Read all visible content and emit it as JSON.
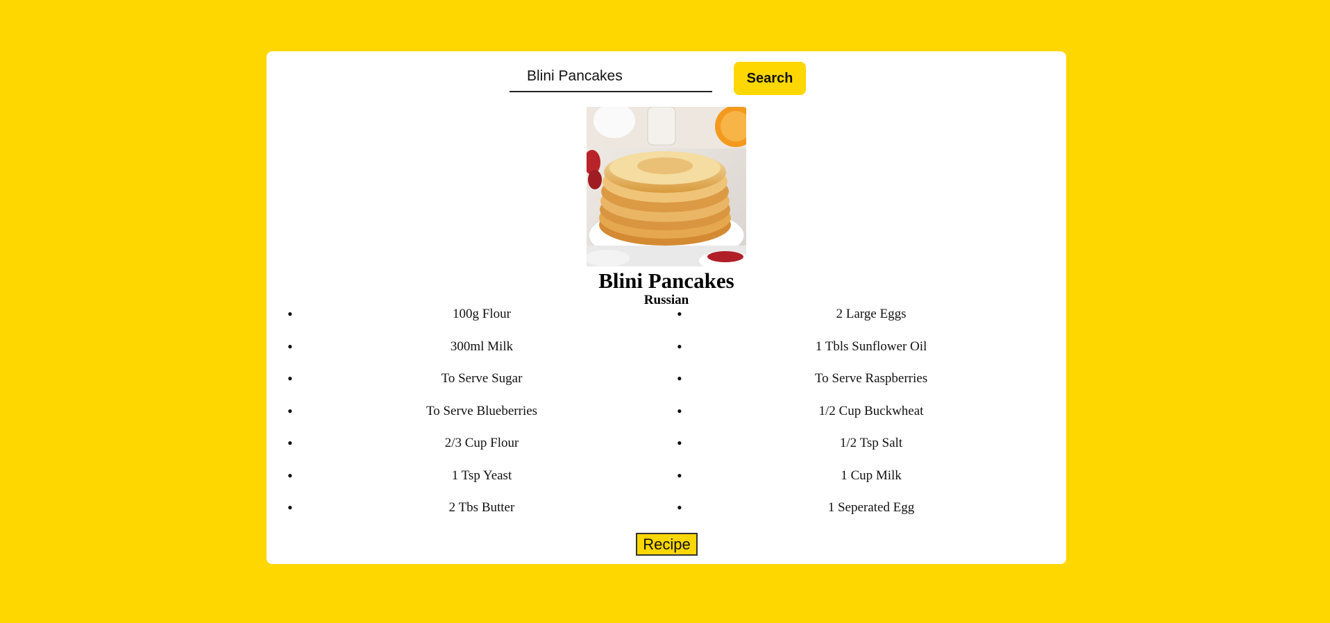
{
  "colors": {
    "background": "#FFD700",
    "card": "#FFFFFF",
    "button": "#FFD700"
  },
  "search": {
    "value": "Blini Pancakes",
    "button_label": "Search",
    "button_icon": "none"
  },
  "meal": {
    "image_icon": "pancakes-photo",
    "title": "Blini Pancakes",
    "area": "Russian",
    "ingredients_left": [
      "100g Flour",
      "300ml Milk",
      "To Serve Sugar",
      "To Serve Blueberries",
      "2/3 Cup Flour",
      "1 Tsp Yeast",
      "2 Tbs Butter"
    ],
    "ingredients_right": [
      "2 Large Eggs",
      "1 Tbls Sunflower Oil",
      "To Serve Raspberries",
      "1/2 Cup Buckwheat",
      "1/2 Tsp Salt",
      "1 Cup Milk",
      "1 Seperated Egg"
    ],
    "recipe_button_label": "Recipe"
  }
}
